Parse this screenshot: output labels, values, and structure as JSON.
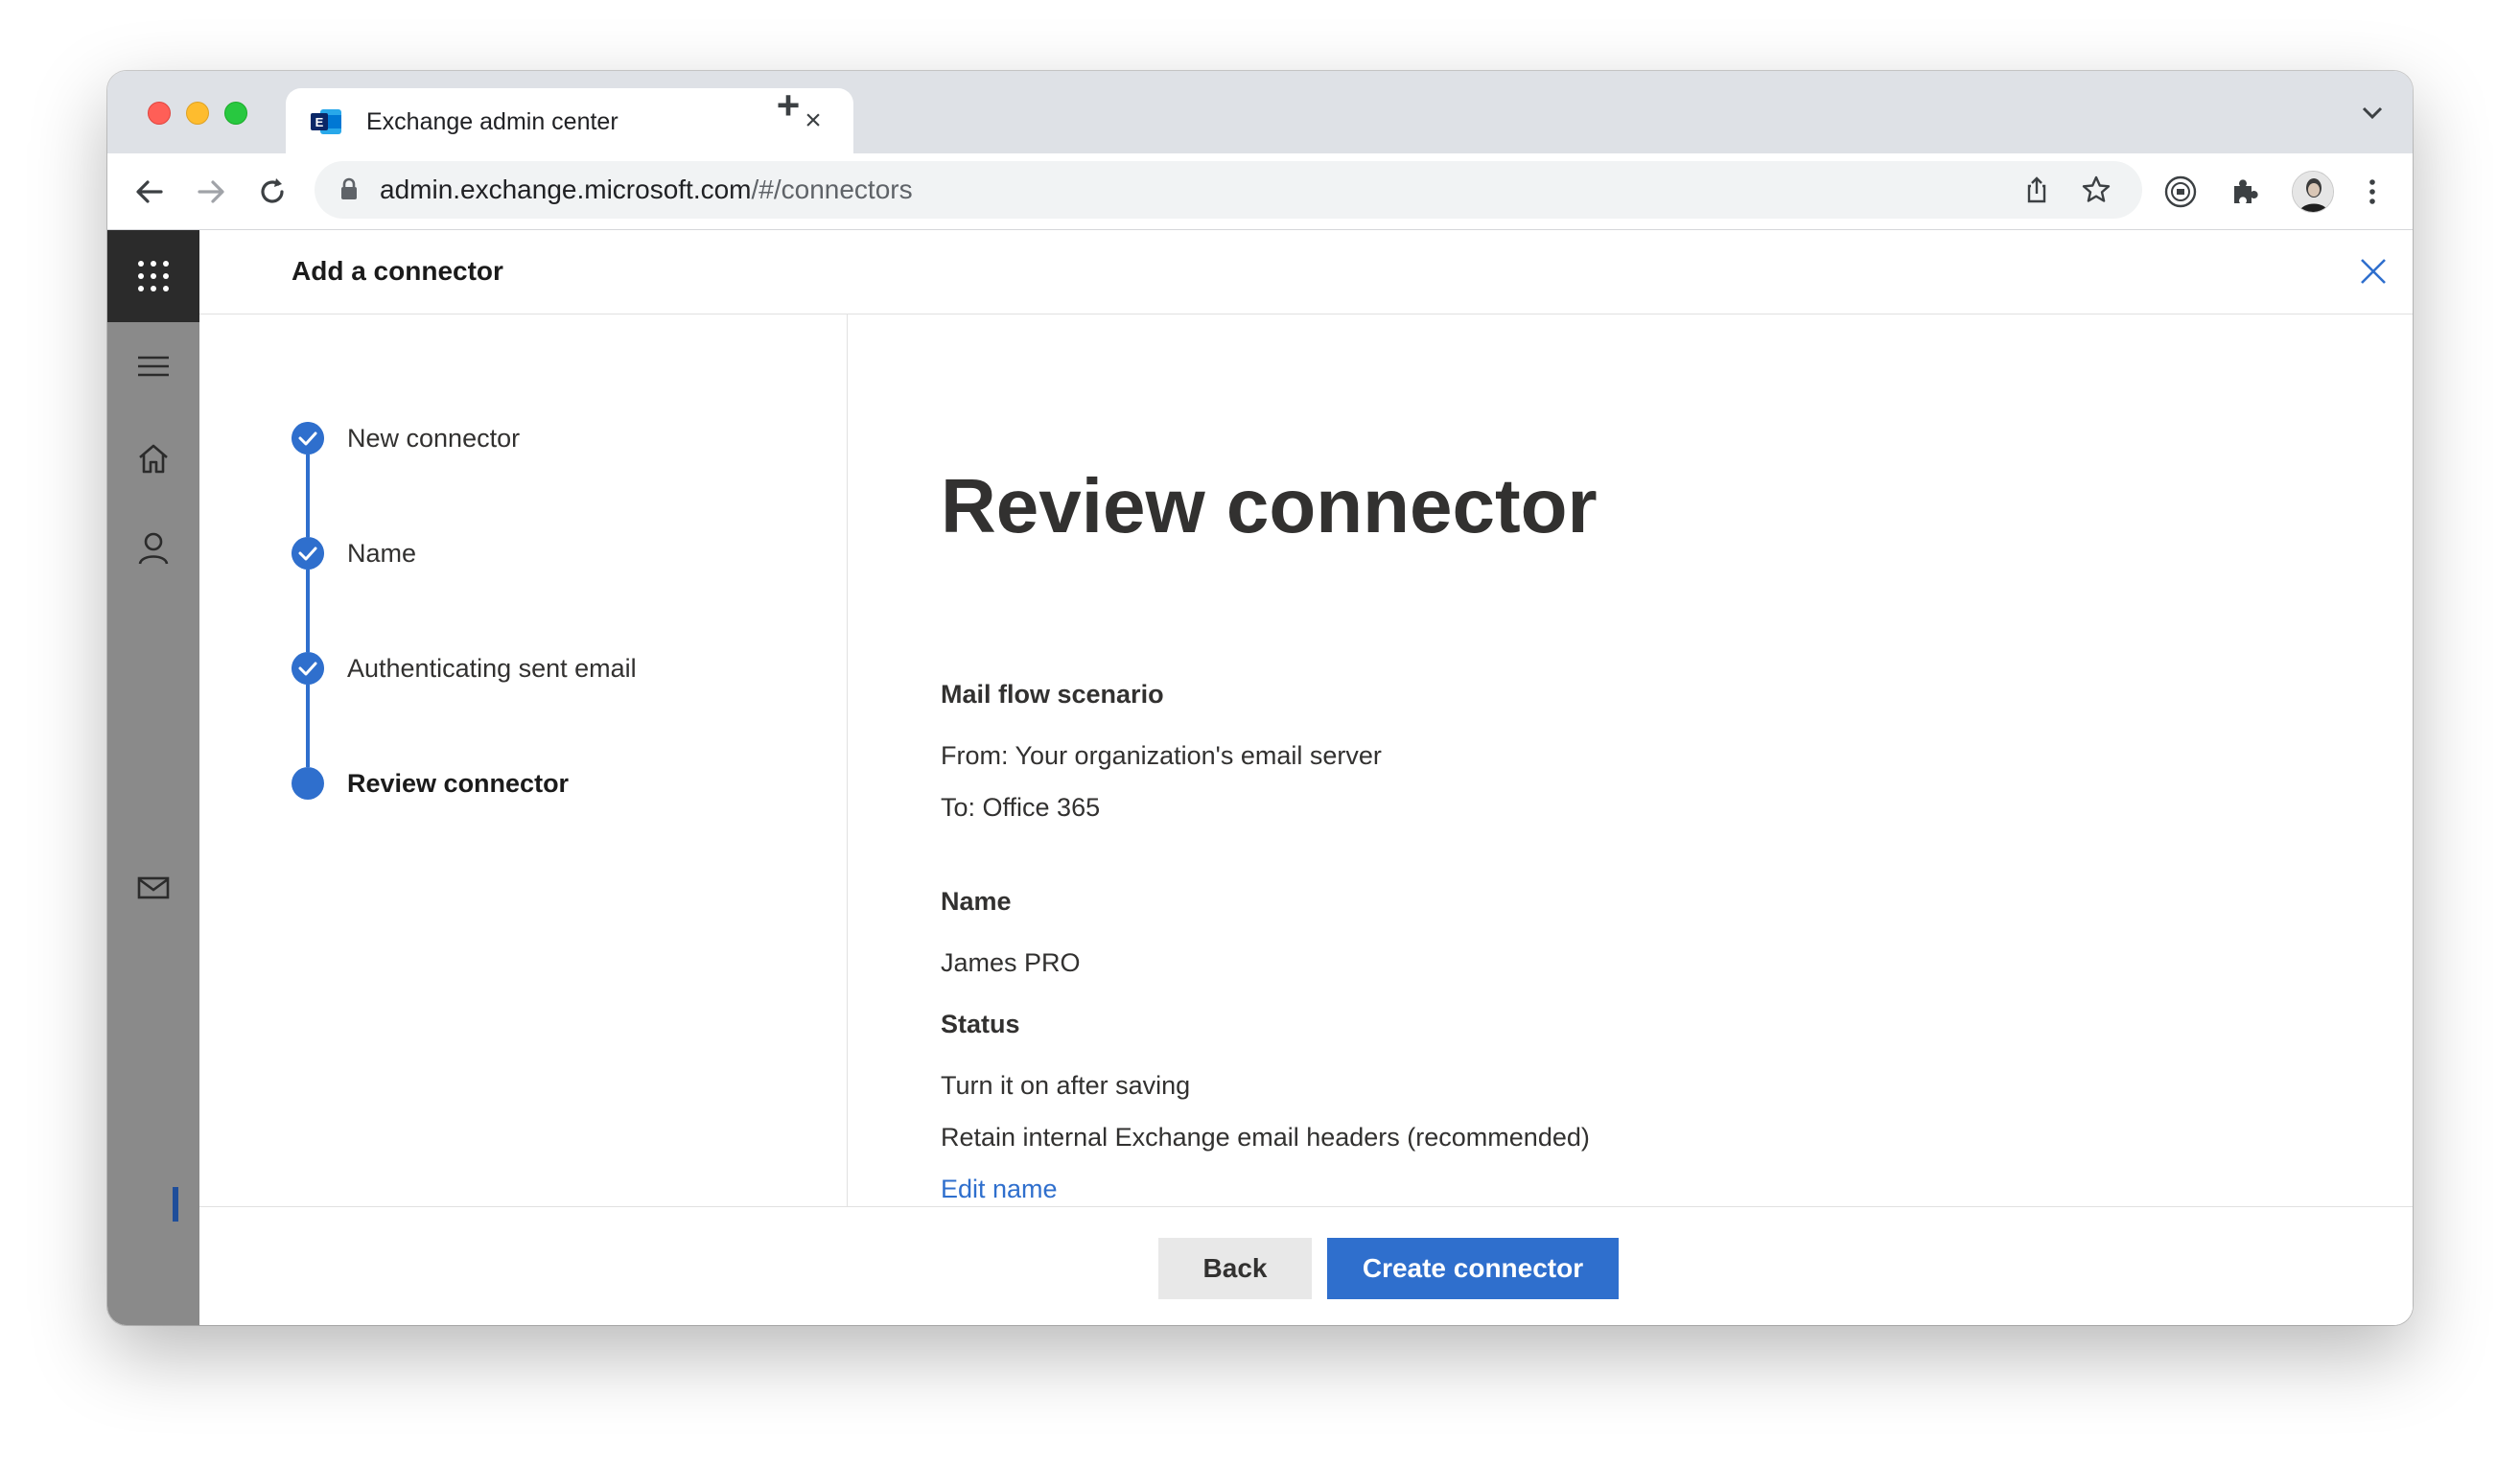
{
  "browser": {
    "tab_title": "Exchange admin center",
    "url_host": "admin.exchange.microsoft.com",
    "url_path": "/#/connectors"
  },
  "panel": {
    "title": "Add a connector"
  },
  "steps": [
    {
      "label": "New connector",
      "state": "done"
    },
    {
      "label": "Name",
      "state": "done"
    },
    {
      "label": "Authenticating sent email",
      "state": "done"
    },
    {
      "label": "Review connector",
      "state": "current"
    }
  ],
  "review": {
    "title": "Review connector",
    "mail_flow_heading": "Mail flow scenario",
    "from": "From: Your organization's email server",
    "to": "To: Office 365",
    "name_heading": "Name",
    "name_value": "James PRO",
    "status_heading": "Status",
    "status_value": "Turn it on after saving",
    "headers_value": "Retain internal Exchange email headers (recommended)",
    "edit_link": "Edit name"
  },
  "footer": {
    "back_label": "Back",
    "create_label": "Create connector"
  },
  "colors": {
    "accent": "#2f6fcd",
    "rail": "#8a8a8a",
    "rail_dark": "#2b2b2b"
  }
}
